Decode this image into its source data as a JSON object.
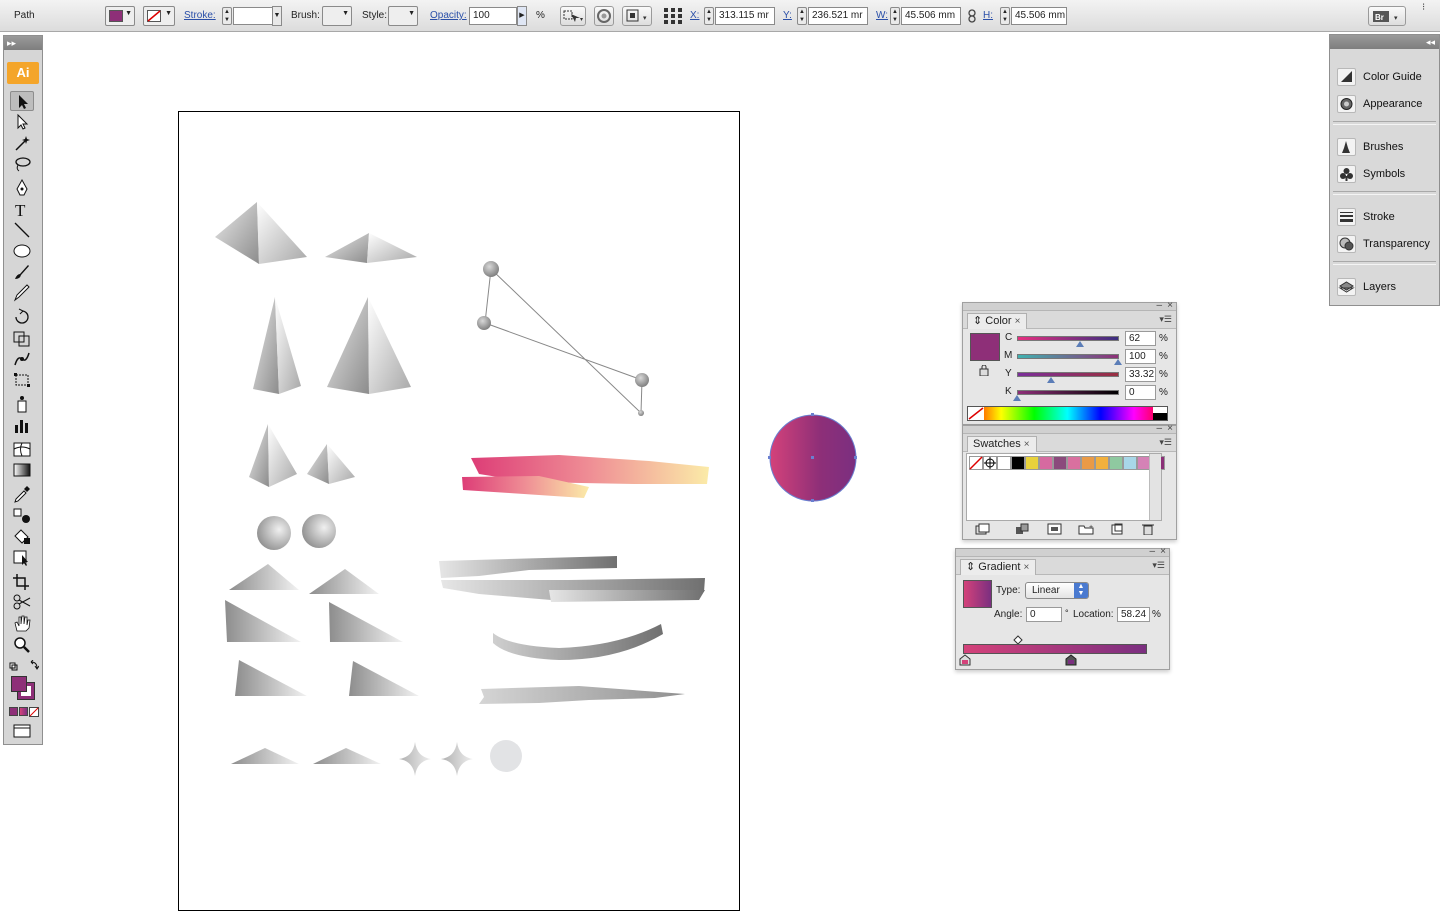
{
  "control_bar": {
    "selection_type": "Path",
    "stroke_label": "Stroke:",
    "brush_label": "Brush:",
    "style_label": "Style:",
    "opacity_label": "Opacity:",
    "opacity_value": "100",
    "opacity_unit": "%",
    "x_label": "X:",
    "x_value": "313.115 mr",
    "y_label": "Y:",
    "y_value": "236.521 mr",
    "w_label": "W:",
    "w_value": "45.506 mm",
    "h_label": "H:",
    "h_value": "45.506 mm"
  },
  "tools_panel": {
    "collapse_glyph": "▸▸",
    "logo_text": "Ai"
  },
  "dock": {
    "collapse_glyph": "◂◂",
    "items": [
      {
        "label": "Color Guide",
        "icon": "color-guide-icon"
      },
      {
        "label": "Appearance",
        "icon": "appearance-icon"
      },
      {
        "label": "Brushes",
        "icon": "brushes-icon"
      },
      {
        "label": "Symbols",
        "icon": "symbols-icon"
      },
      {
        "label": "Stroke",
        "icon": "stroke-icon"
      },
      {
        "label": "Transparency",
        "icon": "transparency-icon"
      },
      {
        "label": "Layers",
        "icon": "layers-icon"
      }
    ]
  },
  "color_panel": {
    "tab": "Color",
    "channels": [
      {
        "label": "C",
        "value": "62",
        "unit": "%"
      },
      {
        "label": "M",
        "value": "100",
        "unit": "%"
      },
      {
        "label": "Y",
        "value": "33.32",
        "unit": "%"
      },
      {
        "label": "K",
        "value": "0",
        "unit": "%"
      }
    ],
    "fill_color": "#8e2f78"
  },
  "swatches_panel": {
    "tab": "Swatches",
    "swatch_colors": [
      "#ffffff",
      "#000000",
      "#e8d23c",
      "#d66aa0",
      "#8b4a7c",
      "#d9709f",
      "#e99a46",
      "#f2b03d",
      "#8fc9a0",
      "#a8d7e8",
      "#d582b6",
      "#8b2f78"
    ]
  },
  "gradient_panel": {
    "tab": "Gradient",
    "type_label": "Type:",
    "type_value": "Linear",
    "angle_label": "Angle:",
    "angle_value": "0",
    "angle_unit": "°",
    "location_label": "Location:",
    "location_value": "58.24",
    "location_unit": "%",
    "start_color": "#d4427a",
    "end_color": "#7b2f80"
  },
  "colors": {
    "accent_magenta": "#8e2f78",
    "gradient_start": "#d4427a",
    "gradient_end": "#7b2f80"
  }
}
